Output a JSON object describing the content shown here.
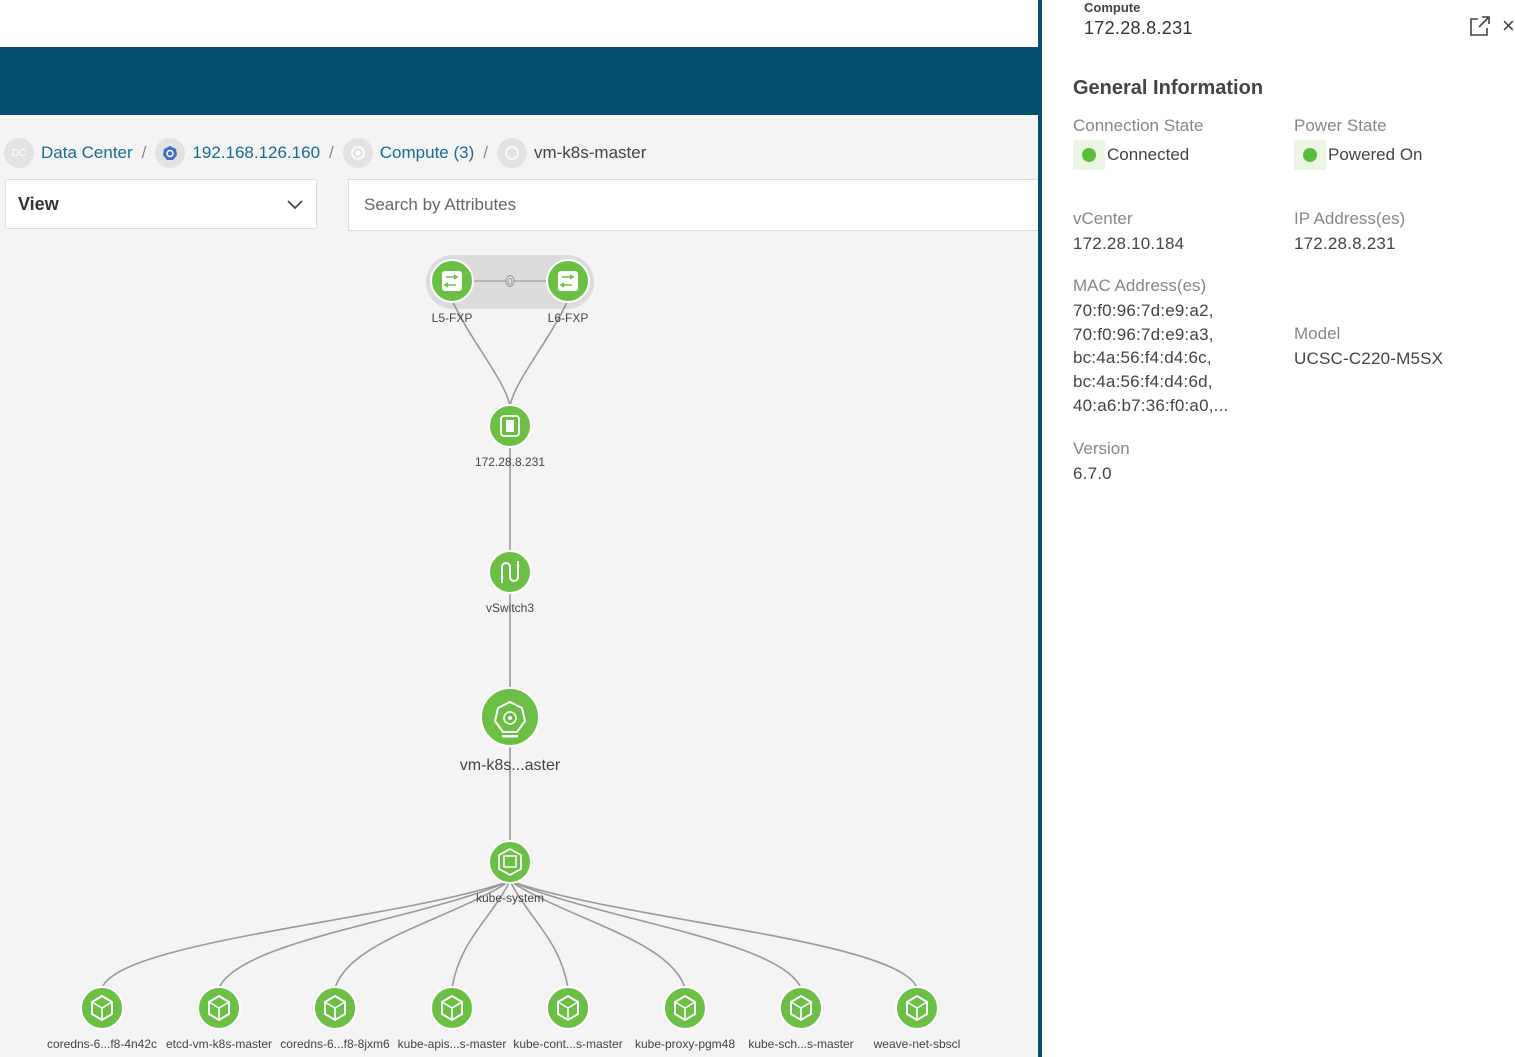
{
  "breadcrumb": {
    "items": [
      {
        "icon": "dc-icon",
        "icon_text": "DC",
        "label": "Data Center"
      },
      {
        "icon": "kubernetes-icon",
        "label": "192.168.126.160"
      },
      {
        "icon": "compute-icon",
        "label": "Compute (3)"
      },
      {
        "icon": "vm-icon",
        "label": "vm-k8s-master"
      }
    ],
    "separator": "/"
  },
  "toolbar": {
    "view_label": "View",
    "search_placeholder": "Search by Attributes"
  },
  "topology": {
    "leaf_link_label": "0",
    "nodes": {
      "leaf1": "L5-FXP",
      "leaf2": "L6-FXP",
      "host": "172.28.8.231",
      "vswitch": "vSwitch3",
      "vm": "vm-k8s...aster",
      "namespace": "kube-system"
    },
    "pods": [
      "coredns-6...f8-4n42c",
      "etcd-vm-k8s-master",
      "coredns-6...f8-8jxm6",
      "kube-apis...s-master",
      "kube-cont...s-master",
      "kube-proxy-pgm48",
      "kube-sch...s-master",
      "weave-net-sbscl"
    ]
  },
  "panel": {
    "type": "Compute",
    "title": "172.28.8.231",
    "section": "General Information",
    "connection_state_label": "Connection State",
    "connection_state": "Connected",
    "power_state_label": "Power State",
    "power_state": "Powered On",
    "vcenter_label": "vCenter",
    "vcenter": "172.28.10.184",
    "ip_label": "IP Address(es)",
    "ip": "172.28.8.231",
    "mac_label": "MAC Address(es)",
    "macs": [
      "70:f0:96:7d:e9:a2,",
      "70:f0:96:7d:e9:a3,",
      "bc:4a:56:f4:d4:6c,",
      "bc:4a:56:f4:d4:6d,",
      "40:a6:b7:36:f0:a0,..."
    ],
    "model_label": "Model",
    "model": "UCSC-C220-M5SX",
    "version_label": "Version",
    "version": "6.7.0",
    "close_glyph": "×"
  },
  "colors": {
    "header_band": "#02506e",
    "node_green": "#6cbf45",
    "status_green": "#5bbd3c",
    "link_blue": "#1b6b94"
  }
}
